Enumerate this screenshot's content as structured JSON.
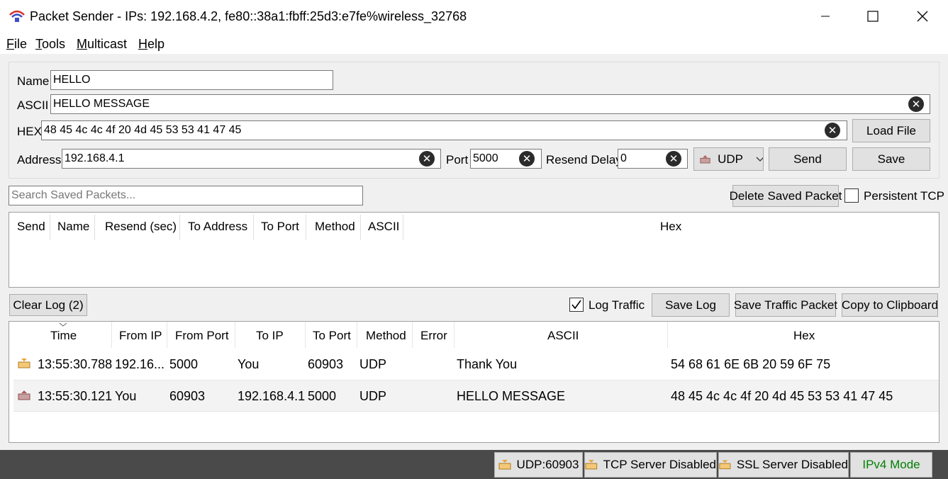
{
  "window": {
    "title": "Packet Sender - IPs: 192.168.4.2, fe80::38a1:fbff:25d3:e7fe%wireless_32768"
  },
  "menu": [
    "File",
    "Tools",
    "Multicast",
    "Help"
  ],
  "form": {
    "name_label": "Name",
    "name_value": "HELLO",
    "ascii_label": "ASCII",
    "ascii_value": "HELLO MESSAGE",
    "hex_label": "HEX",
    "hex_value": "48 45 4c 4c 4f 20 4d 45 53 53 41 47 45",
    "address_label": "Address",
    "address_value": "192.168.4.1",
    "port_label": "Port",
    "port_value": "5000",
    "resend_label": "Resend Delay",
    "resend_value": "0",
    "method_value": "UDP",
    "load_file": "Load File",
    "send": "Send",
    "save": "Save"
  },
  "saved": {
    "search_placeholder": "Search Saved Packets...",
    "delete_button": "Delete Saved Packet",
    "persistent_tcp": "Persistent TCP",
    "persistent_tcp_checked": false,
    "columns": [
      "Send",
      "Name",
      "Resend (sec)",
      "To Address",
      "To Port",
      "Method",
      "ASCII",
      "Hex"
    ]
  },
  "log": {
    "clear_button": "Clear Log (2)",
    "log_traffic": "Log Traffic",
    "log_traffic_checked": true,
    "save_log": "Save Log",
    "save_traffic_packet": "Save Traffic Packet",
    "copy_clipboard": "Copy to Clipboard",
    "columns": [
      "Time",
      "From IP",
      "From Port",
      "To IP",
      "To Port",
      "Method",
      "Error",
      "ASCII",
      "Hex"
    ],
    "rows": [
      {
        "direction": "received",
        "time": "13:55:30.788",
        "from_ip": "192.16...",
        "from_port": "5000",
        "to_ip": "You",
        "to_port": "60903",
        "method": "UDP",
        "error": "",
        "ascii": "Thank You",
        "hex": "54 68 61 6E 6B 20 59 6F 75"
      },
      {
        "direction": "sent",
        "time": "13:55:30.121",
        "from_ip": "You",
        "from_port": "60903",
        "to_ip": "192.168.4.1",
        "to_port": "5000",
        "method": "UDP",
        "error": "",
        "ascii": "HELLO MESSAGE",
        "hex": "48 45 4c 4c 4f 20 4d 45 53 53 41 47 45"
      }
    ]
  },
  "status": {
    "udp": "UDP:60903",
    "tcp": "TCP Server Disabled",
    "ssl": "SSL Server Disabled",
    "ipmode": "IPv4 Mode",
    "ipmode_color": "#008000"
  },
  "colors": {
    "accent_icon": "#e8a23a",
    "sent_icon": "#b05a5a"
  }
}
